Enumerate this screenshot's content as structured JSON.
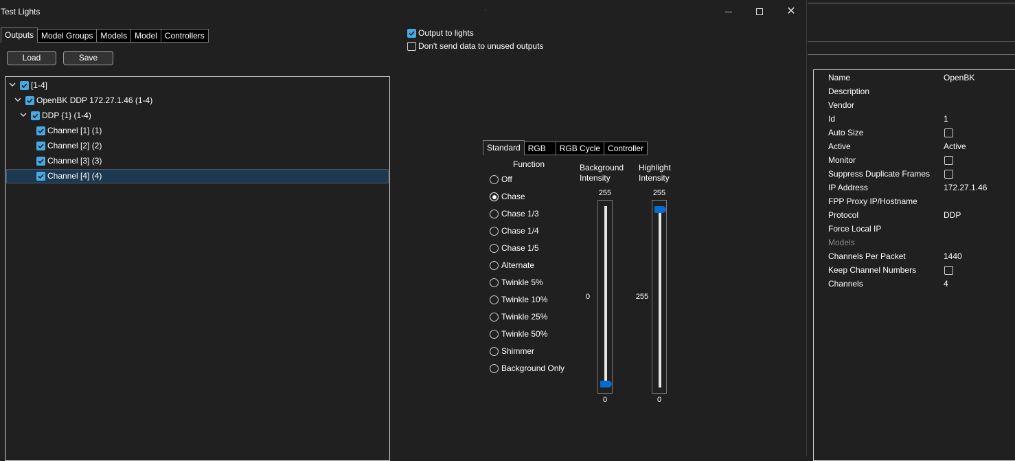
{
  "window": {
    "title": "Test Lights"
  },
  "tabs": [
    "Outputs",
    "Model Groups",
    "Models",
    "Model",
    "Controllers"
  ],
  "buttons": {
    "load": "Load",
    "save": "Save"
  },
  "options": {
    "output_to_lights": {
      "label": "Output to lights",
      "checked": true
    },
    "dont_send_unused": {
      "label": "Don't send data to unused outputs",
      "checked": false
    }
  },
  "tree": {
    "nodes": [
      {
        "label": "[1-4]",
        "checked": true,
        "expanded": true,
        "selected": false
      },
      {
        "label": "OpenBK DDP 172.27.1.46 (1-4)",
        "checked": true,
        "expanded": true,
        "selected": false
      },
      {
        "label": "DDP {1} (1-4)",
        "checked": true,
        "expanded": true,
        "selected": false
      },
      {
        "label": "Channel [1] (1)",
        "checked": true,
        "selected": false
      },
      {
        "label": "Channel [2] (2)",
        "checked": true,
        "selected": false
      },
      {
        "label": "Channel [3] (3)",
        "checked": true,
        "selected": false
      },
      {
        "label": "Channel [4] (4)",
        "checked": true,
        "selected": true
      }
    ]
  },
  "mode_tabs": [
    "Standard",
    "RGB",
    "RGB Cycle",
    "Controller"
  ],
  "function": {
    "heading": "Function",
    "selected": "Chase",
    "options": [
      "Off",
      "Chase",
      "Chase 1/3",
      "Chase 1/4",
      "Chase 1/5",
      "Alternate",
      "Twinkle 5%",
      "Twinkle 10%",
      "Twinkle 25%",
      "Twinkle 50%",
      "Shimmer",
      "Background Only"
    ]
  },
  "background_intensity": {
    "label_line1": "Background",
    "label_line2": "Intensity",
    "max": "255",
    "min": "0",
    "value": "0",
    "level": 0
  },
  "highlight_intensity": {
    "label_line1": "Highlight",
    "label_line2": "Intensity",
    "max": "255",
    "min": "0",
    "value": "255",
    "level": 1
  },
  "properties": [
    {
      "name": "Name",
      "value": "OpenBK"
    },
    {
      "name": "Description",
      "value": ""
    },
    {
      "name": "Vendor",
      "value": ""
    },
    {
      "name": "Id",
      "value": "1"
    },
    {
      "name": "Auto Size",
      "value": "",
      "checkbox": true,
      "checked": false
    },
    {
      "name": "Active",
      "value": "Active"
    },
    {
      "name": "Monitor",
      "value": "",
      "checkbox": true,
      "checked": false
    },
    {
      "name": "Suppress Duplicate Frames",
      "value": "",
      "checkbox": true,
      "checked": false
    },
    {
      "name": "IP Address",
      "value": "172.27.1.46"
    },
    {
      "name": "FPP Proxy IP/Hostname",
      "value": ""
    },
    {
      "name": "Protocol",
      "value": "DDP"
    },
    {
      "name": "Force Local IP",
      "value": ""
    },
    {
      "name": "Models",
      "value": "",
      "disabled": true
    },
    {
      "name": "Channels Per Packet",
      "value": "1440"
    },
    {
      "name": "Keep Channel Numbers",
      "value": "",
      "checkbox": true,
      "checked": false
    },
    {
      "name": "Channels",
      "value": "4"
    }
  ],
  "colors": {
    "accent": "#4aa8e0",
    "slider_thumb": "#0a6ad0",
    "selection": "#1b3a52",
    "background": "#202020"
  }
}
